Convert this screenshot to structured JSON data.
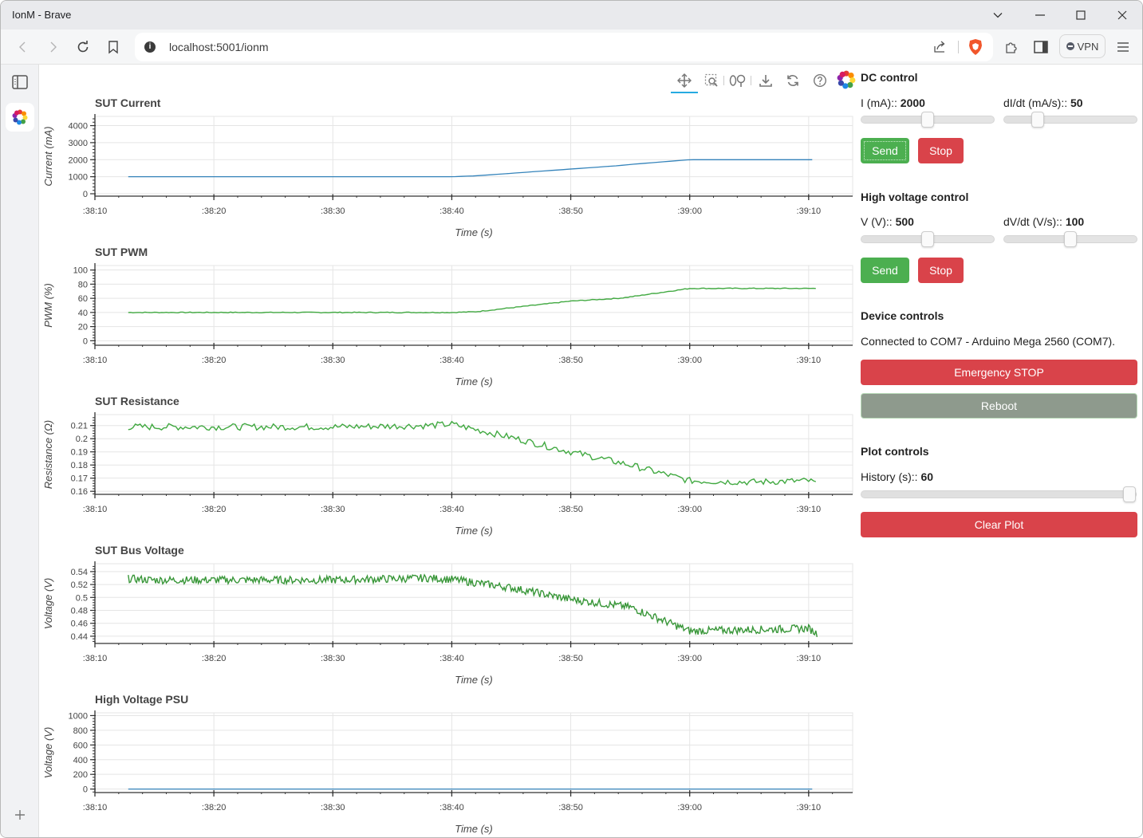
{
  "browser": {
    "window_title": "IonM - Brave",
    "url": "localhost:5001/ionm",
    "vpn_label": "VPN",
    "icons": [
      "back-icon",
      "forward-icon",
      "reload-icon",
      "bookmark-icon",
      "site-info-icon",
      "share-icon",
      "brave-shield-icon",
      "extensions-icon",
      "sidebar-toggle-icon",
      "menu-icon"
    ]
  },
  "plot_toolbar": {
    "tools": [
      "pan",
      "box-zoom",
      "wheel-zoom",
      "save",
      "reset",
      "help"
    ],
    "active_tool": "pan"
  },
  "panel": {
    "dc": {
      "title": "DC control",
      "current_label": "I (mA):: ",
      "current_value": "2000",
      "current_fraction": 0.5,
      "didt_label": "dI/dt (mA/s):: ",
      "didt_value": "50",
      "didt_fraction": 0.25,
      "send": "Send",
      "stop": "Stop"
    },
    "hv": {
      "title": "High voltage control",
      "voltage_label": "V (V):: ",
      "voltage_value": "500",
      "voltage_fraction": 0.5,
      "dvdt_label": "dV/dt (V/s):: ",
      "dvdt_value": "100",
      "dvdt_fraction": 0.5,
      "send": "Send",
      "stop": "Stop"
    },
    "device": {
      "title": "Device controls",
      "status": "Connected to COM7 - Arduino Mega 2560 (COM7).",
      "emergency": "Emergency STOP",
      "reboot": "Reboot"
    },
    "plot_controls": {
      "title": "Plot controls",
      "history_label": "History (s):: ",
      "history_value": "60",
      "history_fraction": 1.0,
      "clear": "Clear Plot"
    }
  },
  "chart_data": [
    {
      "type": "line",
      "title": "SUT Current",
      "xlabel": "Time (s)",
      "ylabel": "Current (mA)",
      "color": "#1f77b4",
      "x_ticks": [
        ":38:10",
        ":38:20",
        ":38:30",
        ":38:40",
        ":38:50",
        ":39:00",
        ":39:10"
      ],
      "y_ticks": [
        "0",
        "1000",
        "2000",
        "3000",
        "4000"
      ],
      "xlim_s": [
        10,
        73.7
      ],
      "ylim": [
        0,
        4400
      ],
      "x_s": [
        12.8,
        20,
        30,
        40,
        42,
        50,
        54,
        55,
        60,
        65,
        70,
        70.7
      ],
      "y": [
        1000,
        1000,
        1000,
        1000,
        1050,
        1450,
        1650,
        1720,
        2000,
        2000,
        2000,
        2000
      ],
      "noise": 0
    },
    {
      "type": "line",
      "title": "SUT PWM",
      "xlabel": "Time (s)",
      "ylabel": "PWM (%)",
      "color": "#2ca02c",
      "x_ticks": [
        ":38:10",
        ":38:20",
        ":38:30",
        ":38:40",
        ":38:50",
        ":39:00",
        ":39:10"
      ],
      "y_ticks": [
        "0",
        "20",
        "40",
        "60",
        "80",
        "100"
      ],
      "xlim_s": [
        10,
        73.7
      ],
      "ylim": [
        -3,
        103
      ],
      "x_s": [
        12.8,
        20,
        30,
        40,
        42,
        50,
        54,
        55,
        60,
        65,
        70,
        70.7
      ],
      "y": [
        40,
        40,
        40,
        40,
        41,
        56,
        60,
        62,
        74,
        74,
        74,
        74
      ],
      "noise": 0.6
    },
    {
      "type": "line",
      "title": "SUT Resistance",
      "xlabel": "Time (s)",
      "ylabel": "Resistance (Ω)",
      "color": "#2ca02c",
      "x_ticks": [
        ":38:10",
        ":38:20",
        ":38:30",
        ":38:40",
        ":38:50",
        ":39:00",
        ":39:10"
      ],
      "y_ticks": [
        "0.16",
        "0.17",
        "0.18",
        "0.19",
        "0.2",
        "0.21"
      ],
      "xlim_s": [
        10,
        73.7
      ],
      "ylim": [
        0.1595,
        0.2165
      ],
      "x_s": [
        12.8,
        15,
        20,
        30,
        38,
        40,
        45,
        50,
        55,
        60,
        65,
        70,
        70.7
      ],
      "y": [
        0.209,
        0.209,
        0.209,
        0.209,
        0.21,
        0.211,
        0.201,
        0.19,
        0.18,
        0.168,
        0.167,
        0.168,
        0.166
      ],
      "noise": 0.0025
    },
    {
      "type": "line",
      "title": "SUT Bus Voltage",
      "xlabel": "Time (s)",
      "ylabel": "Voltage (V)",
      "color": "#228b22",
      "x_ticks": [
        ":38:10",
        ":38:20",
        ":38:30",
        ":38:40",
        ":38:50",
        ":39:00",
        ":39:10"
      ],
      "y_ticks": [
        "0.44",
        "0.46",
        "0.48",
        "0.5",
        "0.52",
        "0.54"
      ],
      "xlim_s": [
        10,
        73.7
      ],
      "ylim": [
        0.4325,
        0.5485
      ],
      "x_s": [
        12.8,
        15,
        20,
        30,
        38,
        40,
        45,
        50,
        55,
        60,
        65,
        70,
        70.7
      ],
      "y": [
        0.529,
        0.527,
        0.527,
        0.527,
        0.53,
        0.528,
        0.515,
        0.497,
        0.485,
        0.448,
        0.45,
        0.452,
        0.444
      ],
      "noise": 0.006
    },
    {
      "type": "line",
      "title": "High Voltage PSU",
      "xlabel": "Time (s)",
      "ylabel": "Voltage (V)",
      "color": "#1f77b4",
      "x_ticks": [
        ":38:10",
        ":38:20",
        ":38:30",
        ":38:40",
        ":38:50",
        ":39:00",
        ":39:10"
      ],
      "y_ticks": [
        "0",
        "200",
        "400",
        "600",
        "800",
        "1000"
      ],
      "xlim_s": [
        10,
        73.7
      ],
      "ylim": [
        -15,
        1005
      ],
      "x_s": [
        12.8,
        70.7
      ],
      "y": [
        0,
        0
      ],
      "noise": 0
    }
  ]
}
